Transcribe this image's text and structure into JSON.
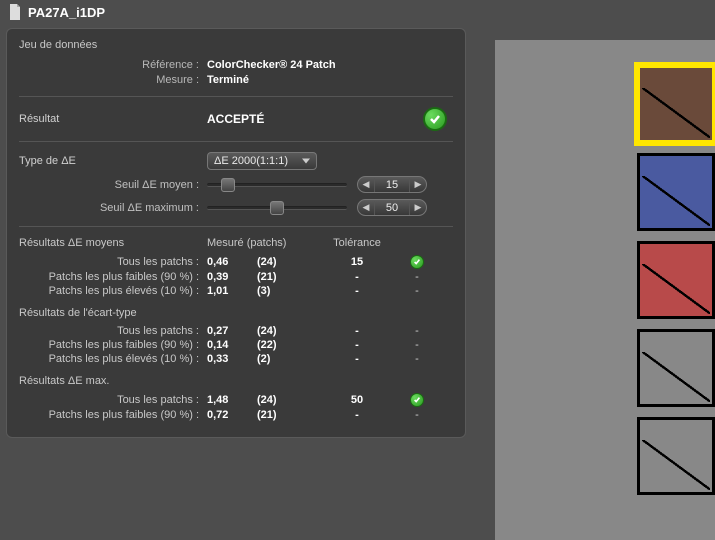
{
  "titlebar": {
    "title": "PA27A_i1DP"
  },
  "dataset": {
    "heading": "Jeu de données",
    "ref_label": "Référence :",
    "ref_value": "ColorChecker® 24 Patch",
    "measure_label": "Mesure :",
    "measure_value": "Terminé"
  },
  "result": {
    "label": "Résultat",
    "value": "ACCEPTÉ"
  },
  "deltaE": {
    "type_label": "Type de ΔE",
    "type_value": "ΔE 2000(1:1:1)",
    "avg_threshold_label": "Seuil ΔE moyen :",
    "avg_threshold_value": "15",
    "avg_threshold_percent": 15,
    "max_threshold_label": "Seuil ΔE maximum :",
    "max_threshold_value": "50",
    "max_threshold_percent": 50
  },
  "tables": {
    "col_measured": "Mesuré (patchs)",
    "col_tolerance": "Tolérance",
    "avg_heading": "Résultats ΔE moyens",
    "std_heading": "Résultats de l'écart-type",
    "max_heading": "Résultats ΔE max.",
    "row_all": "Tous les patchs :",
    "row_best": "Patchs les plus faibles (90 %) :",
    "row_worst": "Patchs les plus élevés (10 %) :",
    "avg": {
      "all": {
        "v": "0,46",
        "n": "(24)",
        "tol": "15",
        "ok": true
      },
      "best": {
        "v": "0,39",
        "n": "(21)",
        "tol": "-",
        "ok": false
      },
      "worst": {
        "v": "1,01",
        "n": "(3)",
        "tol": "-",
        "ok": false
      }
    },
    "std": {
      "all": {
        "v": "0,27",
        "n": "(24)",
        "tol": "-",
        "ok": false
      },
      "best": {
        "v": "0,14",
        "n": "(22)",
        "tol": "-",
        "ok": false
      },
      "worst": {
        "v": "0,33",
        "n": "(2)",
        "tol": "-",
        "ok": false
      }
    },
    "max": {
      "all": {
        "v": "1,48",
        "n": "(24)",
        "tol": "50",
        "ok": true
      },
      "best": {
        "v": "0,72",
        "n": "(21)",
        "tol": "-",
        "ok": false
      }
    }
  },
  "swatches": [
    {
      "color": "#6a4a3a",
      "selected": true
    },
    {
      "color": "#4a5aa0",
      "selected": false
    },
    {
      "color": "#b84a4a",
      "selected": false
    },
    {
      "color": "#888888",
      "selected": false
    },
    {
      "color": "#888888",
      "selected": false
    }
  ]
}
